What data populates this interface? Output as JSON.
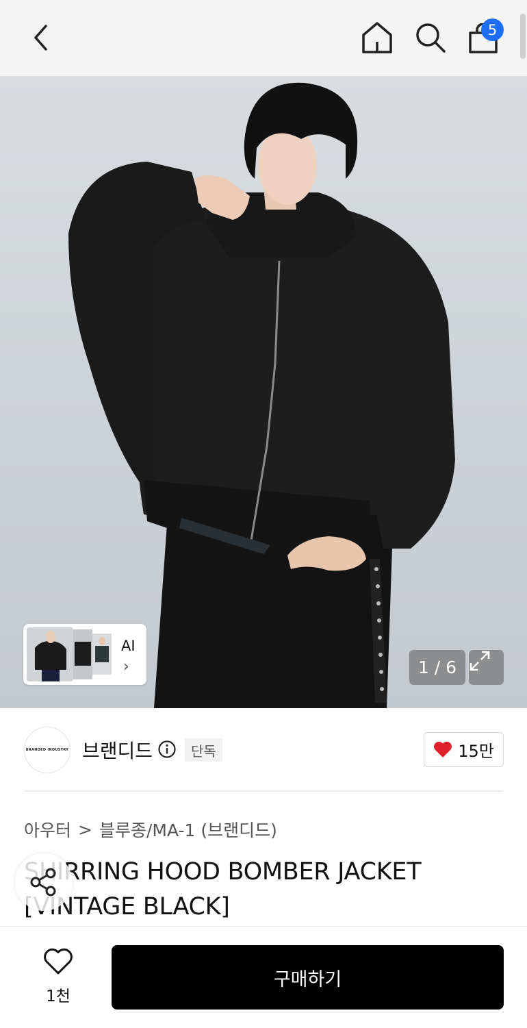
{
  "header": {
    "back_icon": "chevron-left-icon",
    "home_icon": "home-icon",
    "search_icon": "search-icon",
    "cart_icon": "shopping-bag-icon",
    "cart_count": "5"
  },
  "gallery": {
    "counter": "1 / 6",
    "ai_label": "AI",
    "ai_chevron": "›",
    "expand_icon": "expand-icon"
  },
  "brand": {
    "logo_text": "BRANDED INDUSTRY",
    "name": "브랜디드",
    "tag": "단독",
    "like_count": "15만"
  },
  "category": {
    "level1": "아우터",
    "separator": ">",
    "level2": "블루종/MA-1 (브랜디드)"
  },
  "product": {
    "title": "SHIRRING HOOD BOMBER JACKET [VINTAGE BLACK]"
  },
  "bottom": {
    "wish_count": "1천",
    "buy_label": "구매하기"
  },
  "colors": {
    "accent": "#1e6ef5",
    "heart": "#e0202a",
    "buy_button": "#000000"
  }
}
